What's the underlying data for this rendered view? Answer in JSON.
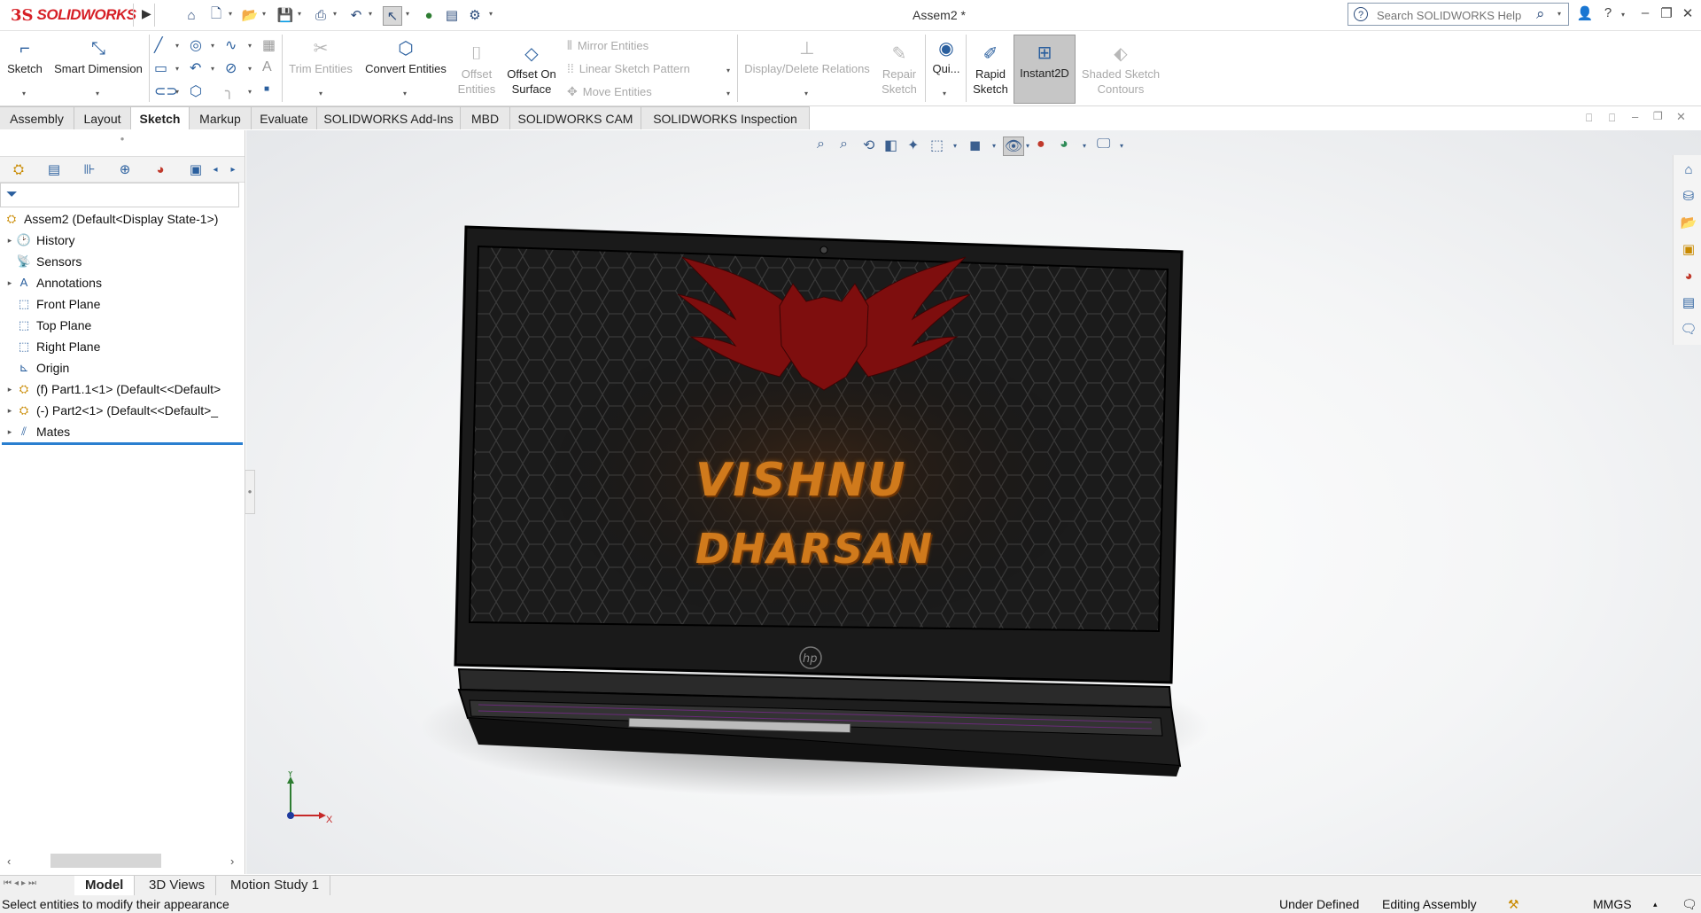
{
  "app": {
    "brand": "SOLIDWORKS",
    "brand_prefix": "3S",
    "doc_title": "Assem2 *"
  },
  "search": {
    "placeholder": "Search SOLIDWORKS Help"
  },
  "commands": {
    "sketch": "Sketch",
    "smart_dimension": "Smart Dimension",
    "trim_entities": "Trim Entities",
    "convert_entities": "Convert Entities",
    "offset_entities_1": "Offset",
    "offset_entities_2": "Entities",
    "offset_on_surface_1": "Offset On",
    "offset_on_surface_2": "Surface",
    "mirror_entities": "Mirror Entities",
    "linear_sketch_pattern": "Linear Sketch Pattern",
    "move_entities": "Move Entities",
    "display_delete_relations": "Display/Delete Relations",
    "repair_sketch_1": "Repair",
    "repair_sketch_2": "Sketch",
    "quick_snaps": "Qui...",
    "rapid_sketch_1": "Rapid",
    "rapid_sketch_2": "Sketch",
    "instant2d": "Instant2D",
    "shaded_sketch_1": "Shaded Sketch",
    "shaded_sketch_2": "Contours"
  },
  "tabs": [
    "Assembly",
    "Layout",
    "Sketch",
    "Markup",
    "Evaluate",
    "SOLIDWORKS Add-Ins",
    "MBD",
    "SOLIDWORKS CAM",
    "SOLIDWORKS Inspection"
  ],
  "active_tab": "Sketch",
  "tree": {
    "root": "Assem2  (Default<Display State-1>)",
    "items": [
      {
        "label": "History",
        "expandable": true
      },
      {
        "label": "Sensors",
        "expandable": false
      },
      {
        "label": "Annotations",
        "expandable": true
      },
      {
        "label": "Front Plane",
        "expandable": false
      },
      {
        "label": "Top Plane",
        "expandable": false
      },
      {
        "label": "Right Plane",
        "expandable": false
      },
      {
        "label": "Origin",
        "expandable": false
      },
      {
        "label": "(f) Part1.1<1> (Default<<Default>",
        "expandable": true
      },
      {
        "label": "(-) Part2<1> (Default<<Default>_",
        "expandable": true
      },
      {
        "label": "Mates",
        "expandable": true
      }
    ]
  },
  "screen": {
    "line1": "VISHNU",
    "line2": "DHARSAN",
    "brand_mark": "hp"
  },
  "triad": {
    "x": "X",
    "y": "Y"
  },
  "bottom_tabs": [
    "Model",
    "3D Views",
    "Motion Study 1"
  ],
  "active_bottom_tab": "Model",
  "status": {
    "message": "Select entities to modify their appearance",
    "definition": "Under Defined",
    "mode": "Editing Assembly",
    "units": "MMGS"
  },
  "colors": {
    "brand_red": "#d61f26",
    "accent_blue": "#2a7fd0",
    "logo_red": "#8a1010",
    "name_orange": "#d07a1c"
  }
}
